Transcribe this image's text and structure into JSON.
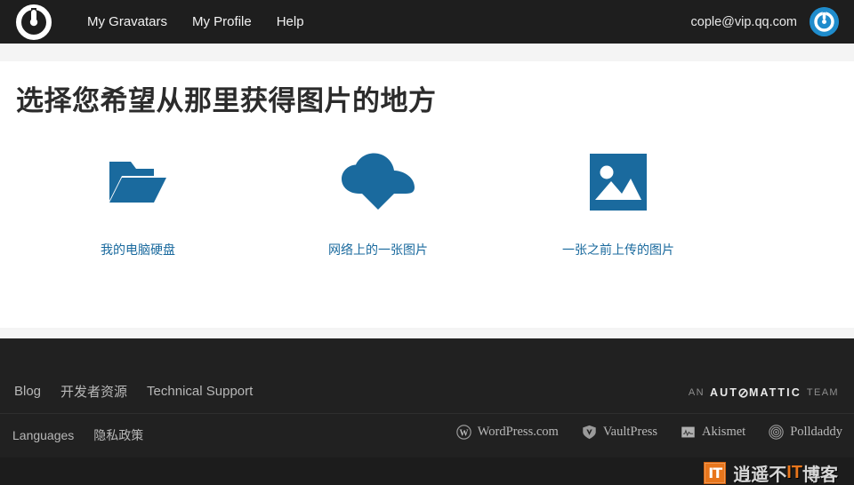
{
  "header": {
    "logo_icon": "gravatar-logo-icon",
    "nav": [
      {
        "label": "My Gravatars"
      },
      {
        "label": "My Profile"
      },
      {
        "label": "Help"
      }
    ],
    "account_email": "cople@vip.qq.com",
    "avatar_icon": "gravatar-avatar-icon"
  },
  "main": {
    "title": "选择您希望从那里获得图片的地方",
    "options": [
      {
        "icon": "open-folder-icon",
        "label": "我的电脑硬盘"
      },
      {
        "icon": "cloud-download-icon",
        "label": "网络上的一张图片"
      },
      {
        "icon": "photo-image-icon",
        "label": "一张之前上传的图片"
      }
    ]
  },
  "footer": {
    "primary_links": [
      {
        "label": "Blog"
      },
      {
        "label": "开发者资源"
      },
      {
        "label": "Technical Support"
      }
    ],
    "secondary_links": [
      {
        "label": "Languages"
      },
      {
        "label": "隐私政策"
      }
    ],
    "automattic": {
      "prefix": "AN",
      "name_part1": "AUT",
      "name_part2": "MATTIC",
      "suffix": "TEAM"
    },
    "brands": [
      {
        "label": "WordPress.com",
        "icon": "wordpress-icon"
      },
      {
        "label": "VaultPress",
        "icon": "vaultpress-shield-icon"
      },
      {
        "label": "Akismet",
        "icon": "akismet-icon"
      },
      {
        "label": "Polldaddy",
        "icon": "polldaddy-icon"
      }
    ]
  },
  "watermark": {
    "badge": "IT",
    "text_part1": "逍遥不",
    "text_highlight": "IT",
    "text_part2": "博客"
  },
  "colors": {
    "accent_blue": "#1a6a9e",
    "nav_dark": "#1e1e1e",
    "footer_dark": "#212121",
    "avatar_blue": "#1f8ccc",
    "watermark_orange": "#e8761c"
  }
}
